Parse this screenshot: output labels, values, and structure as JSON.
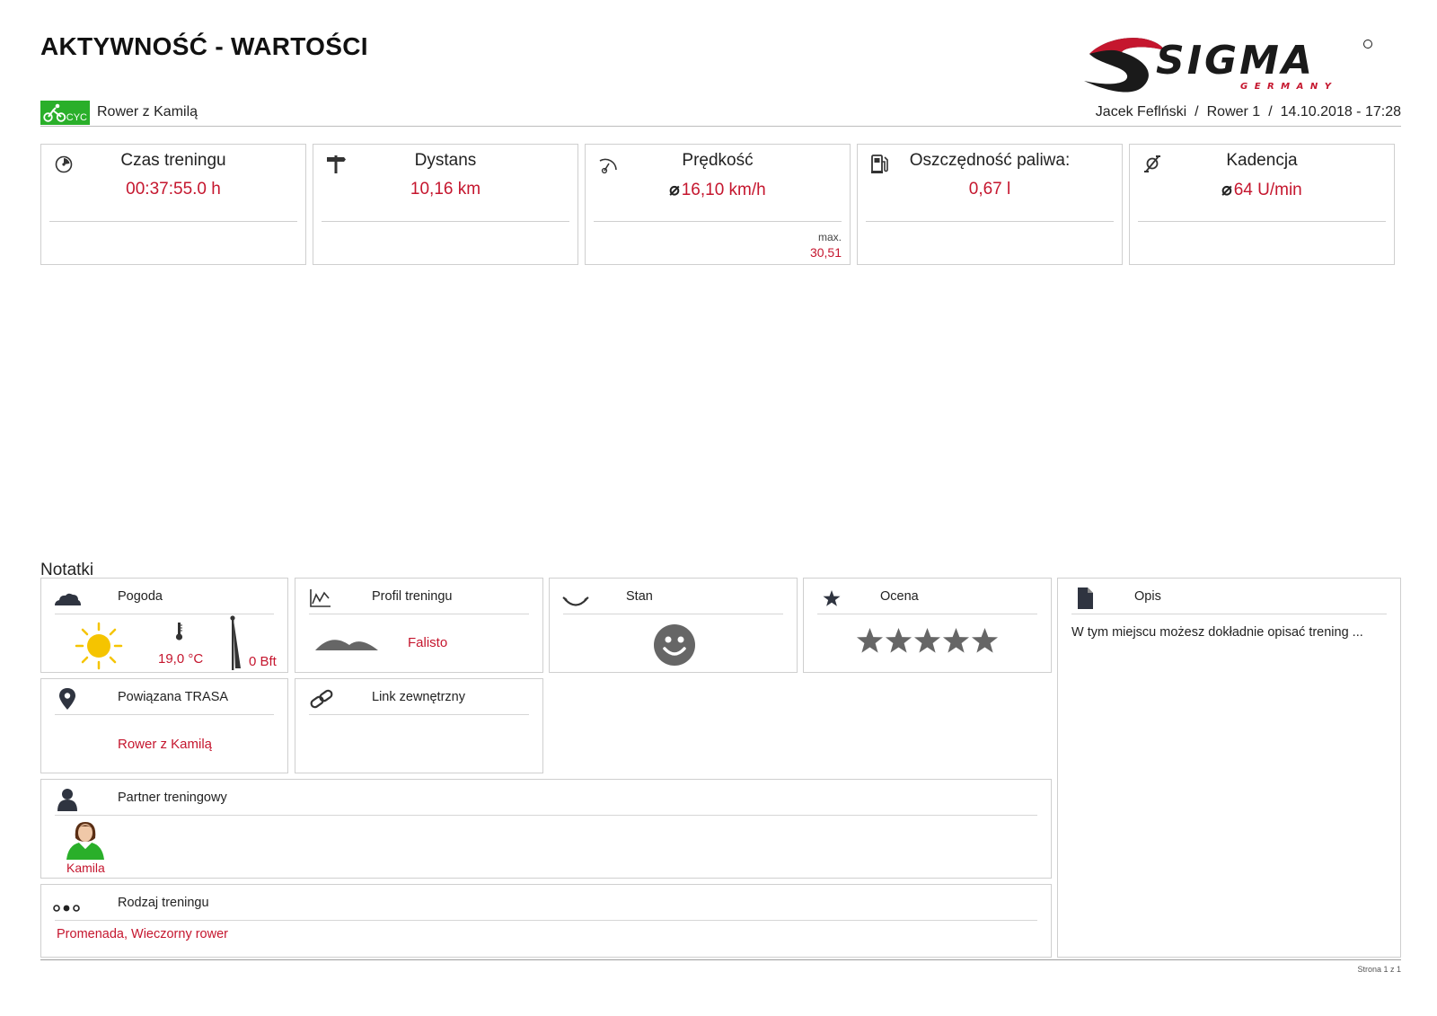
{
  "header": {
    "title": "AKTYWNOŚĆ - WARTOŚCI",
    "brand": "SIGMA",
    "brand_sub": "G E R M A N Y",
    "category_badge": "CYC",
    "activity_name": "Rower z Kamilą",
    "user": "Jacek Feflński",
    "bike": "Rower 1",
    "datetime": "14.10.2018 - 17:28"
  },
  "stats": [
    {
      "label": "Czas treningu",
      "value": "00:37:55.0 h",
      "icon": "stopwatch-icon"
    },
    {
      "label": "Dystans",
      "value": "10,16 km",
      "icon": "signpost-icon"
    },
    {
      "label": "Prędkość",
      "value": "16,10 km/h",
      "avg_symbol": "⌀",
      "max_label": "max.",
      "max_value": "30,51",
      "icon": "speedometer-icon"
    },
    {
      "label": "Oszczędność paliwa:",
      "value": "0,67 l",
      "icon": "fuel-pump-icon"
    },
    {
      "label": "Kadencja",
      "value": "64 U/min",
      "avg_symbol": "⌀",
      "icon": "cadence-icon"
    }
  ],
  "notes": {
    "title": "Notatki",
    "weather": {
      "label": "Pogoda",
      "temperature": "19,0 °C",
      "wind": "0 Bft",
      "icon": "cloud-icon"
    },
    "profile": {
      "label": "Profil treningu",
      "value": "Falisto",
      "icon": "chart-line-icon"
    },
    "mood": {
      "label": "Stan",
      "icon": "mood-icon"
    },
    "rating": {
      "label": "Ocena",
      "stars": 5,
      "max_stars": 5,
      "icon": "star-icon"
    },
    "description": {
      "label": "Opis",
      "text": "W tym miejscu możesz dokładnie opisać trening ...",
      "icon": "document-icon"
    },
    "route": {
      "label": "Powiązana TRASA",
      "value": "Rower z Kamilą",
      "icon": "location-pin-icon"
    },
    "link": {
      "label": "Link zewnętrzny",
      "icon": "link-icon"
    },
    "partner": {
      "label": "Partner treningowy",
      "name": "Kamila",
      "icon": "person-icon"
    },
    "training_type": {
      "label": "Rodzaj treningu",
      "value": "Promenada, Wieczorny rower",
      "icon": "three-dots-icon"
    }
  },
  "footer": {
    "page": "Strona 1 z 1"
  },
  "colors": {
    "accent_red": "#c5162e",
    "badge_green": "#2aaf2a",
    "sun_yellow": "#f5c400"
  }
}
